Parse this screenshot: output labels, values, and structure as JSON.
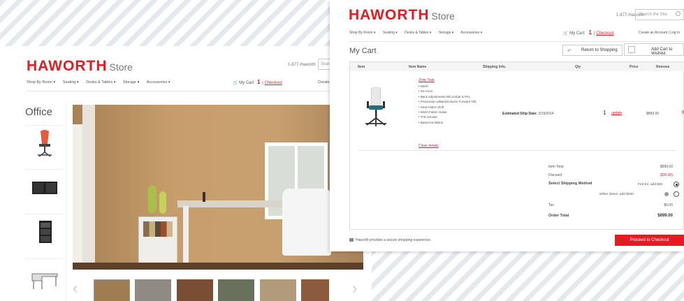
{
  "brand": {
    "logo": "HAWORTH",
    "store": "Store",
    "accent": "#e31b23"
  },
  "back_screen": {
    "phone": "1-877-Haworth",
    "search_placeholder": "Sear",
    "nav": [
      "Shop By Room ▾",
      "Seating ▾",
      "Desks & Tables ▾",
      "Storage ▾",
      "Accessories ▾"
    ],
    "cart_label": "My Cart",
    "cart_count": "1",
    "checkout": "Checkout",
    "create": "Create",
    "side_title": "Office",
    "side_thumbs": [
      "office-chair",
      "credenza",
      "mobile-pedestal",
      "l-desk"
    ],
    "carousel_thumbs": 6
  },
  "front_screen": {
    "phone": "1-877-Haworth",
    "search_placeholder": "Search the Site",
    "nav": [
      "Shop By Room ▾",
      "Seating ▾",
      "Desks & Tables ▾",
      "Storage ▾",
      "Accessories ▾"
    ],
    "cart_label": "My Cart:",
    "cart_count": "1",
    "checkout": "Checkout",
    "account": "Create an Account | Log In",
    "page_title": "My Cart",
    "return_btn": "Return to Shopping",
    "wishlist_btn": "Add Cart to Wishlist",
    "columns": [
      "Item",
      "Item Name",
      "Shipping Info.",
      "Qty",
      "Price",
      "Remove"
    ],
    "item": {
      "name": "Zody Task",
      "details": [
        "Mesh",
        "4D Arms",
        "Back Adjustments:W/Lumbar & PAL",
        "Pneumatic w/Backlock(w/o Forward Tilt)",
        "Seat Fabric:Shift",
        "Mesh Fabric:Halas",
        "Trim:Smoke",
        "Base/Arm:Black"
      ],
      "close_details": "Close details",
      "ship_label": "Estimated Ship Date:",
      "ship_date": "2/19/2014",
      "qty": "1",
      "update": "update",
      "price": "$899.00",
      "remove": "X"
    },
    "totals": {
      "item_total_label": "Item Total",
      "item_total": "$899.00",
      "discount_label": "Discount",
      "discount": "($30.00)",
      "shipping_label": "Select Shipping Method",
      "option1": "Fed Ex: add $30",
      "option2": "White Glove: add $250",
      "tax_label": "Tax",
      "tax": "$0.00",
      "order_total_label": "Order Total",
      "order_total": "$899.00"
    },
    "secure_text": "Haworth provides a secure shopping experience.",
    "checkout_btn": "Proceed to Checkout"
  }
}
